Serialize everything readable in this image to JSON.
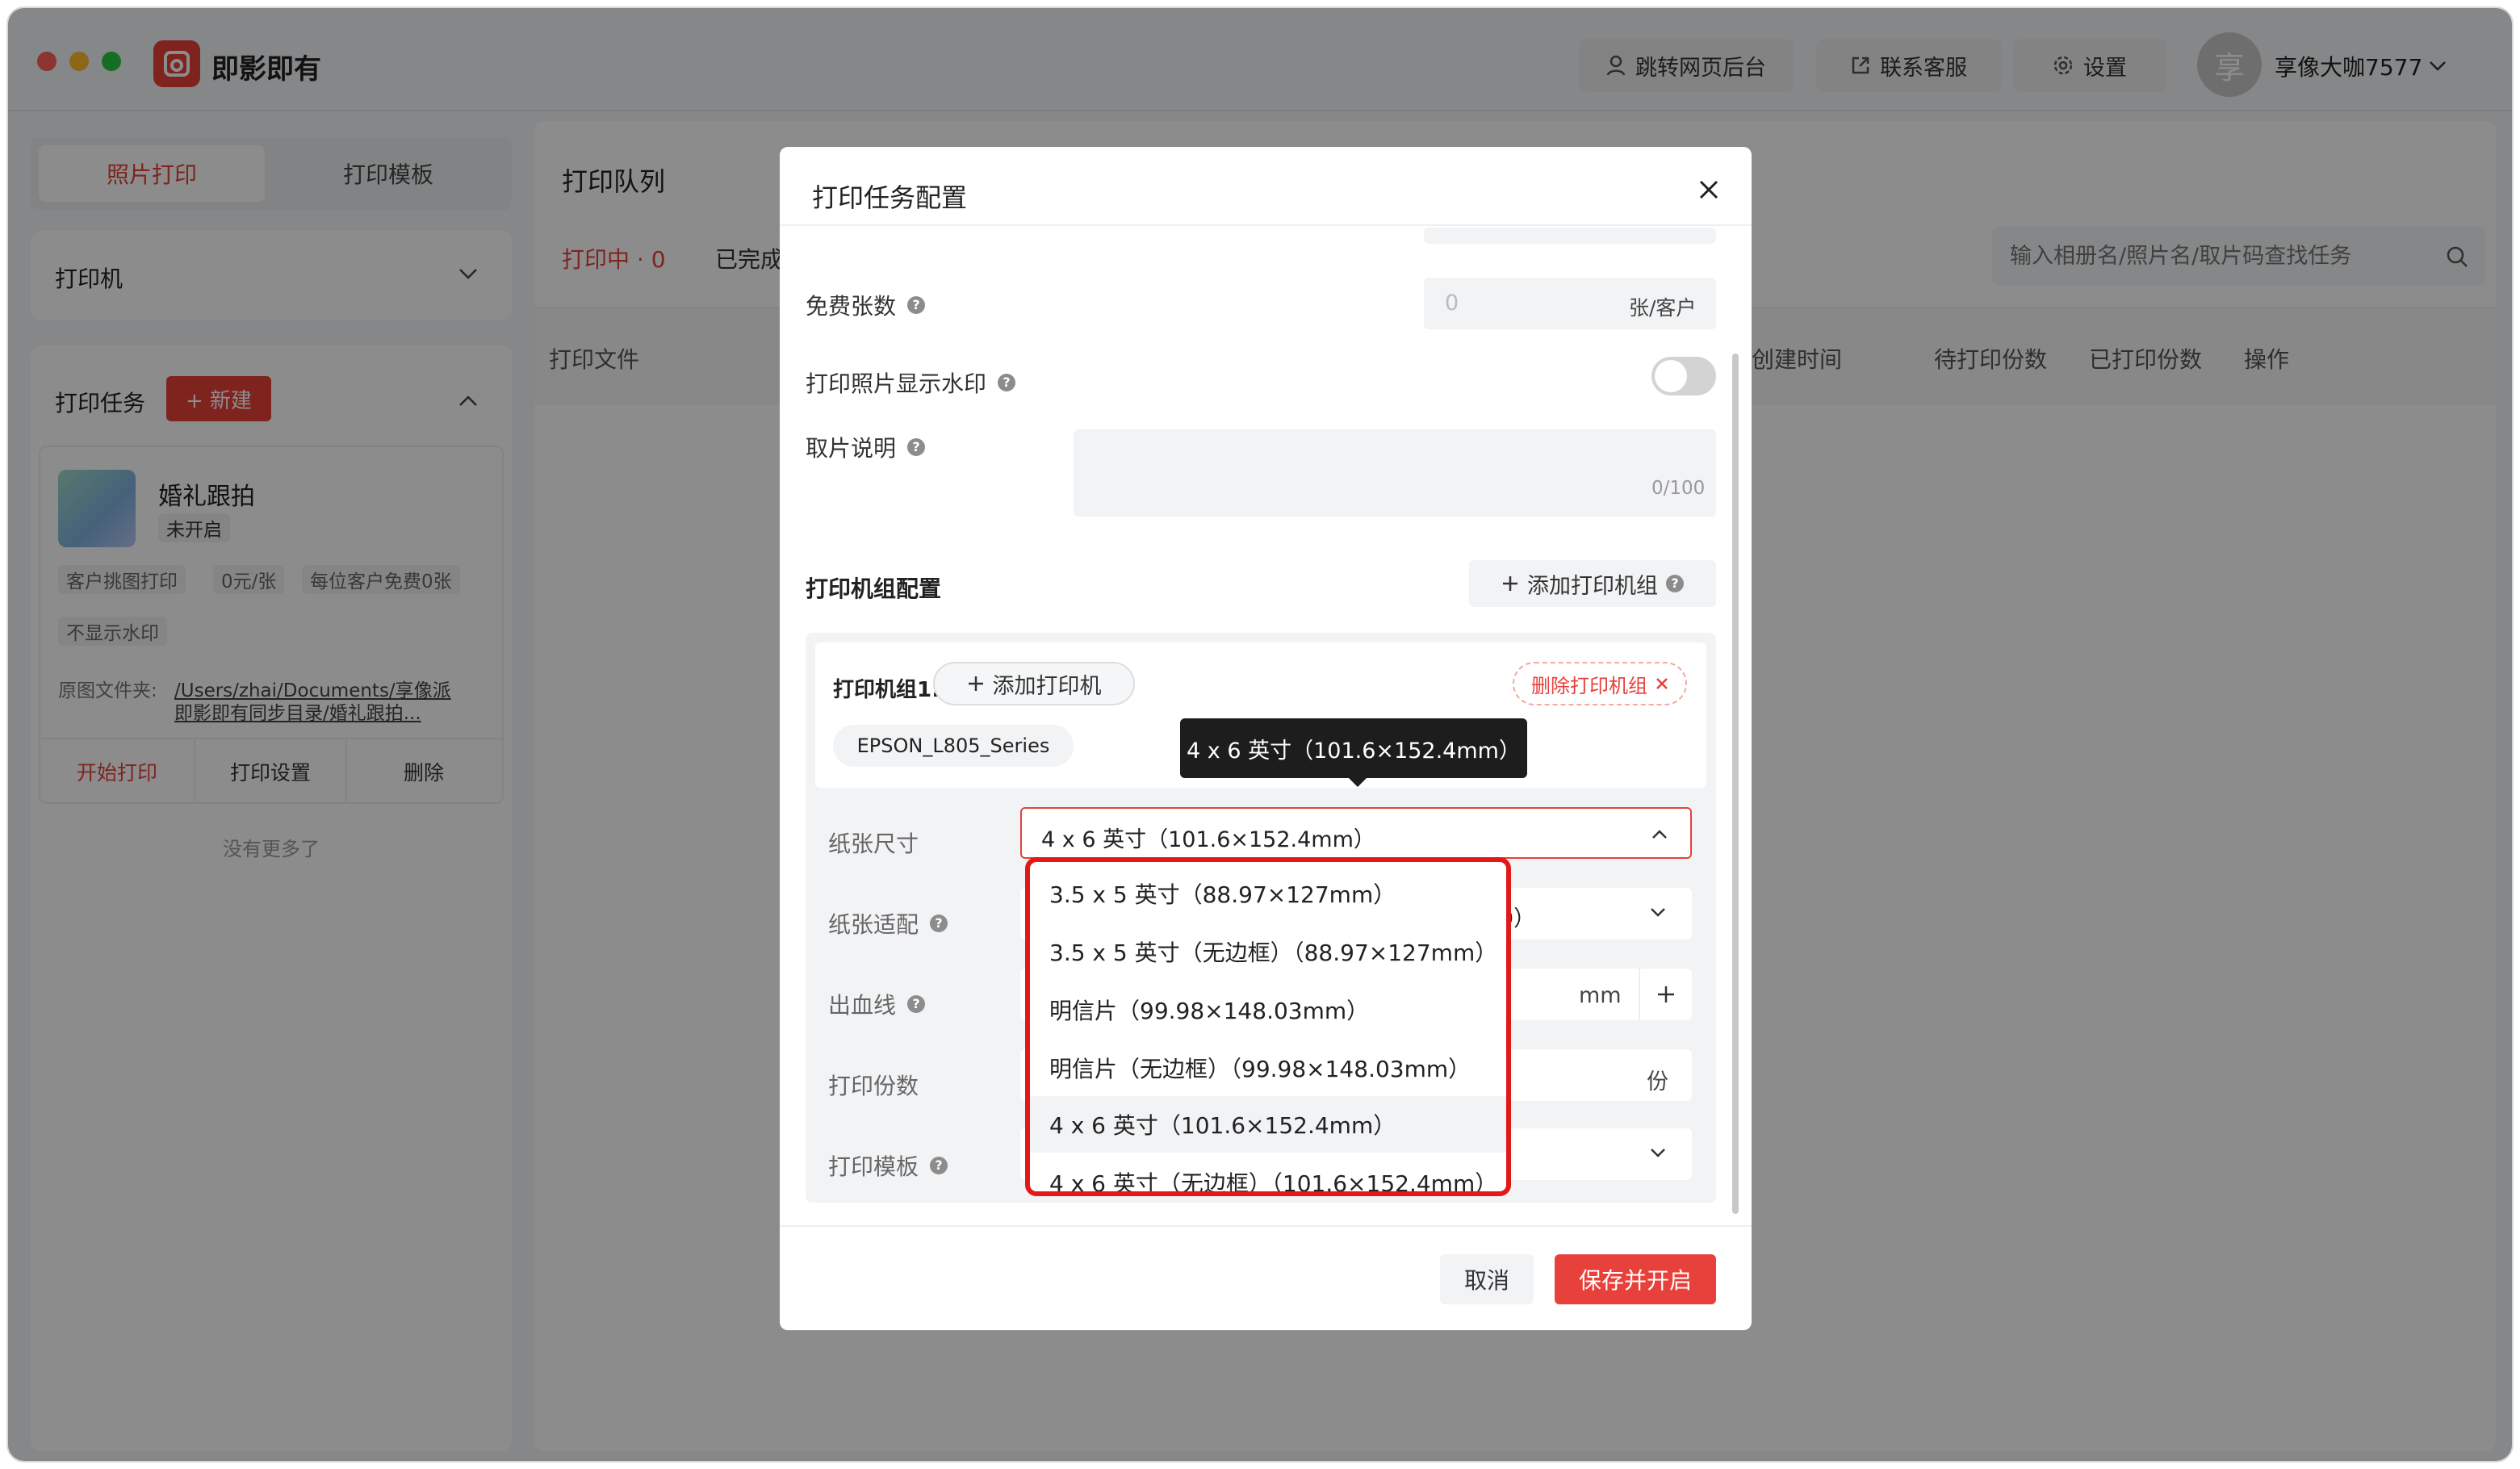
{
  "app": {
    "name": "即影即有",
    "brand_color": "#e8403a"
  },
  "header": {
    "web_admin": "跳转网页后台",
    "support": "联系客服",
    "settings": "设置",
    "avatar_char": "享",
    "username": "享像大咖7577"
  },
  "sidebar": {
    "tabs": [
      "照片打印",
      "打印模板"
    ],
    "printer_section": "打印机",
    "tasks_section": "打印任务",
    "new_button": "+ 新建",
    "task": {
      "name": "婚礼跟拍",
      "status": "未开启",
      "tags": [
        "客户挑图打印",
        "0元/张",
        "每位客户免费0张",
        "不显示水印"
      ],
      "folder_label": "原图文件夹:",
      "folder_path_1": "/Users/zhai/Documents/享像派",
      "folder_path_2": "即影即有同步目录/婚礼跟拍...",
      "actions": [
        "开始打印",
        "打印设置",
        "删除"
      ]
    },
    "no_more": "没有更多了"
  },
  "main": {
    "title": "打印队列",
    "tabs": [
      "打印中 · 0",
      "已完成"
    ],
    "search_placeholder": "输入相册名/照片名/取片码查找任务",
    "columns": [
      "打印文件",
      "创建时间",
      "待打印份数",
      "已打印份数",
      "操作"
    ]
  },
  "modal": {
    "title": "打印任务配置",
    "free_count_label": "免费张数",
    "free_count_value": "0",
    "free_count_unit": "张/客户",
    "watermark_label": "打印照片显示水印",
    "watermark_on": false,
    "pickup_label": "取片说明",
    "pickup_counter": "0/100",
    "printer_config_label": "打印机组配置",
    "add_group_button": "添加打印机组",
    "group": {
      "label": "打印机组1:",
      "add_printer": "添加打印机",
      "delete_group": "删除打印机组",
      "printer": "EPSON_L805_Series"
    },
    "paper_size_label": "纸张尺寸",
    "paper_size_value": "4 x 6 英寸（101.6×152.4mm）",
    "paper_fit_label": "纸张适配",
    "paper_fit_partial": "9）",
    "bleed_label": "出血线",
    "bleed_unit": "mm",
    "copies_label": "打印份数",
    "copies_unit": "份",
    "template_label": "打印模板",
    "tooltip": "4 x 6 英寸（101.6×152.4mm）",
    "dropdown_options": [
      "3.5 x 5 英寸（88.97×127mm）",
      "3.5 x 5 英寸（无边框）（88.97×127mm）",
      "明信片（99.98×148.03mm）",
      "明信片（无边框）（99.98×148.03mm）",
      "4 x 6 英寸（101.6×152.4mm）",
      "4 x 6 英寸（无边框）（101.6×152.4mm）"
    ],
    "selected_option_index": 4,
    "cancel": "取消",
    "save": "保存并开启"
  }
}
